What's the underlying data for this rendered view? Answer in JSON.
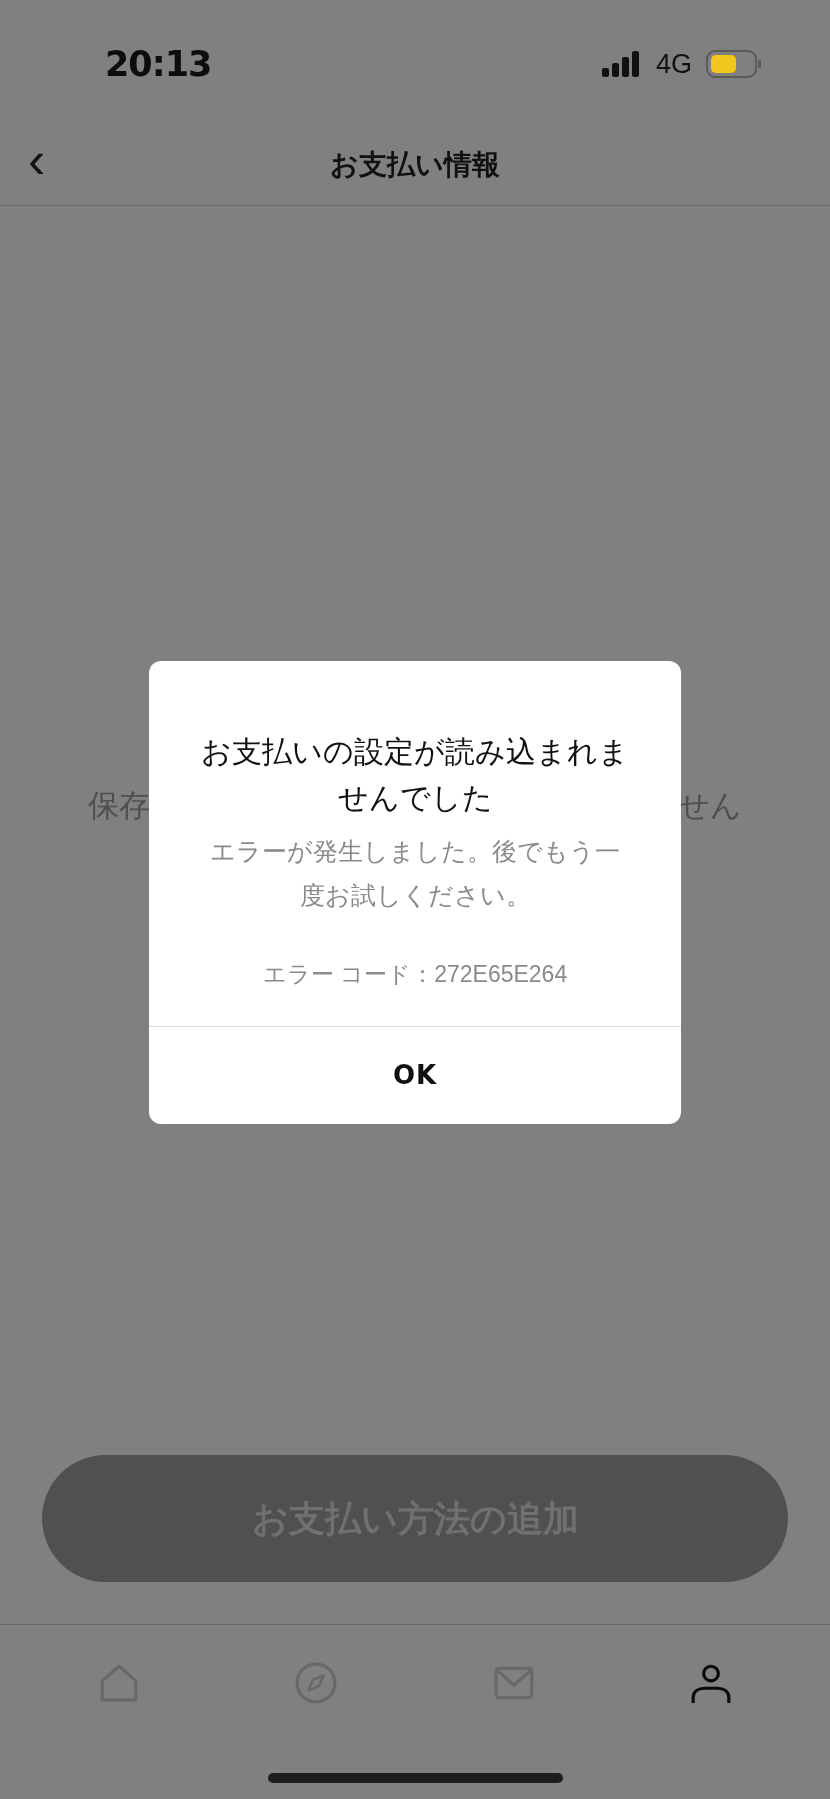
{
  "status_bar": {
    "time": "20:13",
    "network": "4G"
  },
  "nav": {
    "back": "‹",
    "title": "お支払い情報"
  },
  "background_text": {
    "left": "保存",
    "right": "せん"
  },
  "add_button": {
    "label": "お支払い方法の追加",
    "disabled": true
  },
  "tabs": [
    {
      "kind": "home",
      "selected": false
    },
    {
      "kind": "compass",
      "selected": false
    },
    {
      "kind": "mail",
      "selected": false
    },
    {
      "kind": "person",
      "selected": true
    }
  ],
  "dialog": {
    "title": "お支払いの設定が読み込まれませんでした",
    "message": "エラーが発生しました。後でもう一度お試しください。",
    "error_code": "エラー コード：272E65E264",
    "button": "OK"
  }
}
